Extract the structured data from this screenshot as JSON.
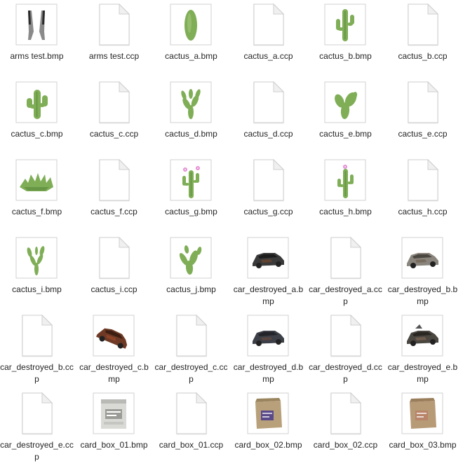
{
  "files": [
    {
      "name": "arms test.bmp",
      "kind": "image",
      "icon": "arms-thumbnail"
    },
    {
      "name": "arms test.ccp",
      "kind": "doc",
      "icon": "blank-document-icon"
    },
    {
      "name": "cactus_a.bmp",
      "kind": "image",
      "icon": "cactus-a-thumbnail"
    },
    {
      "name": "cactus_a.ccp",
      "kind": "doc",
      "icon": "blank-document-icon"
    },
    {
      "name": "cactus_b.bmp",
      "kind": "image",
      "icon": "cactus-b-thumbnail"
    },
    {
      "name": "cactus_b.ccp",
      "kind": "doc",
      "icon": "blank-document-icon"
    },
    {
      "name": "cactus_c.bmp",
      "kind": "image",
      "icon": "cactus-c-thumbnail"
    },
    {
      "name": "cactus_c.ccp",
      "kind": "doc",
      "icon": "blank-document-icon"
    },
    {
      "name": "cactus_d.bmp",
      "kind": "image",
      "icon": "cactus-d-thumbnail"
    },
    {
      "name": "cactus_d.ccp",
      "kind": "doc",
      "icon": "blank-document-icon"
    },
    {
      "name": "cactus_e.bmp",
      "kind": "image",
      "icon": "cactus-e-thumbnail"
    },
    {
      "name": "cactus_e.ccp",
      "kind": "doc",
      "icon": "blank-document-icon"
    },
    {
      "name": "cactus_f.bmp",
      "kind": "image",
      "icon": "cactus-f-thumbnail"
    },
    {
      "name": "cactus_f.ccp",
      "kind": "doc",
      "icon": "blank-document-icon"
    },
    {
      "name": "cactus_g.bmp",
      "kind": "image",
      "icon": "cactus-g-thumbnail"
    },
    {
      "name": "cactus_g.ccp",
      "kind": "doc",
      "icon": "blank-document-icon"
    },
    {
      "name": "cactus_h.bmp",
      "kind": "image",
      "icon": "cactus-h-thumbnail"
    },
    {
      "name": "cactus_h.ccp",
      "kind": "doc",
      "icon": "blank-document-icon"
    },
    {
      "name": "cactus_i.bmp",
      "kind": "image",
      "icon": "cactus-i-thumbnail"
    },
    {
      "name": "cactus_i.ccp",
      "kind": "doc",
      "icon": "blank-document-icon"
    },
    {
      "name": "cactus_j.bmp",
      "kind": "image",
      "icon": "cactus-j-thumbnail"
    },
    {
      "name": "car_destroyed_a.bmp",
      "kind": "image",
      "icon": "car-a-thumbnail"
    },
    {
      "name": "car_destroyed_a.ccp",
      "kind": "doc",
      "icon": "blank-document-icon"
    },
    {
      "name": "car_destroyed_b.bmp",
      "kind": "image",
      "icon": "car-b-thumbnail"
    },
    {
      "name": "car_destroyed_b.ccp",
      "kind": "doc",
      "icon": "blank-document-icon"
    },
    {
      "name": "car_destroyed_c.bmp",
      "kind": "image",
      "icon": "car-c-thumbnail"
    },
    {
      "name": "car_destroyed_c.ccp",
      "kind": "doc",
      "icon": "blank-document-icon"
    },
    {
      "name": "car_destroyed_d.bmp",
      "kind": "image",
      "icon": "car-d-thumbnail"
    },
    {
      "name": "car_destroyed_d.ccp",
      "kind": "doc",
      "icon": "blank-document-icon"
    },
    {
      "name": "car_destroyed_e.bmp",
      "kind": "image",
      "icon": "car-e-thumbnail"
    },
    {
      "name": "car_destroyed_e.ccp",
      "kind": "doc",
      "icon": "blank-document-icon"
    },
    {
      "name": "card_box_01.bmp",
      "kind": "image",
      "icon": "box-01-thumbnail"
    },
    {
      "name": "card_box_01.ccp",
      "kind": "doc",
      "icon": "blank-document-icon"
    },
    {
      "name": "card_box_02.bmp",
      "kind": "image",
      "icon": "box-02-thumbnail"
    },
    {
      "name": "card_box_02.ccp",
      "kind": "doc",
      "icon": "blank-document-icon"
    },
    {
      "name": "card_box_03.bmp",
      "kind": "image",
      "icon": "box-03-thumbnail"
    }
  ]
}
